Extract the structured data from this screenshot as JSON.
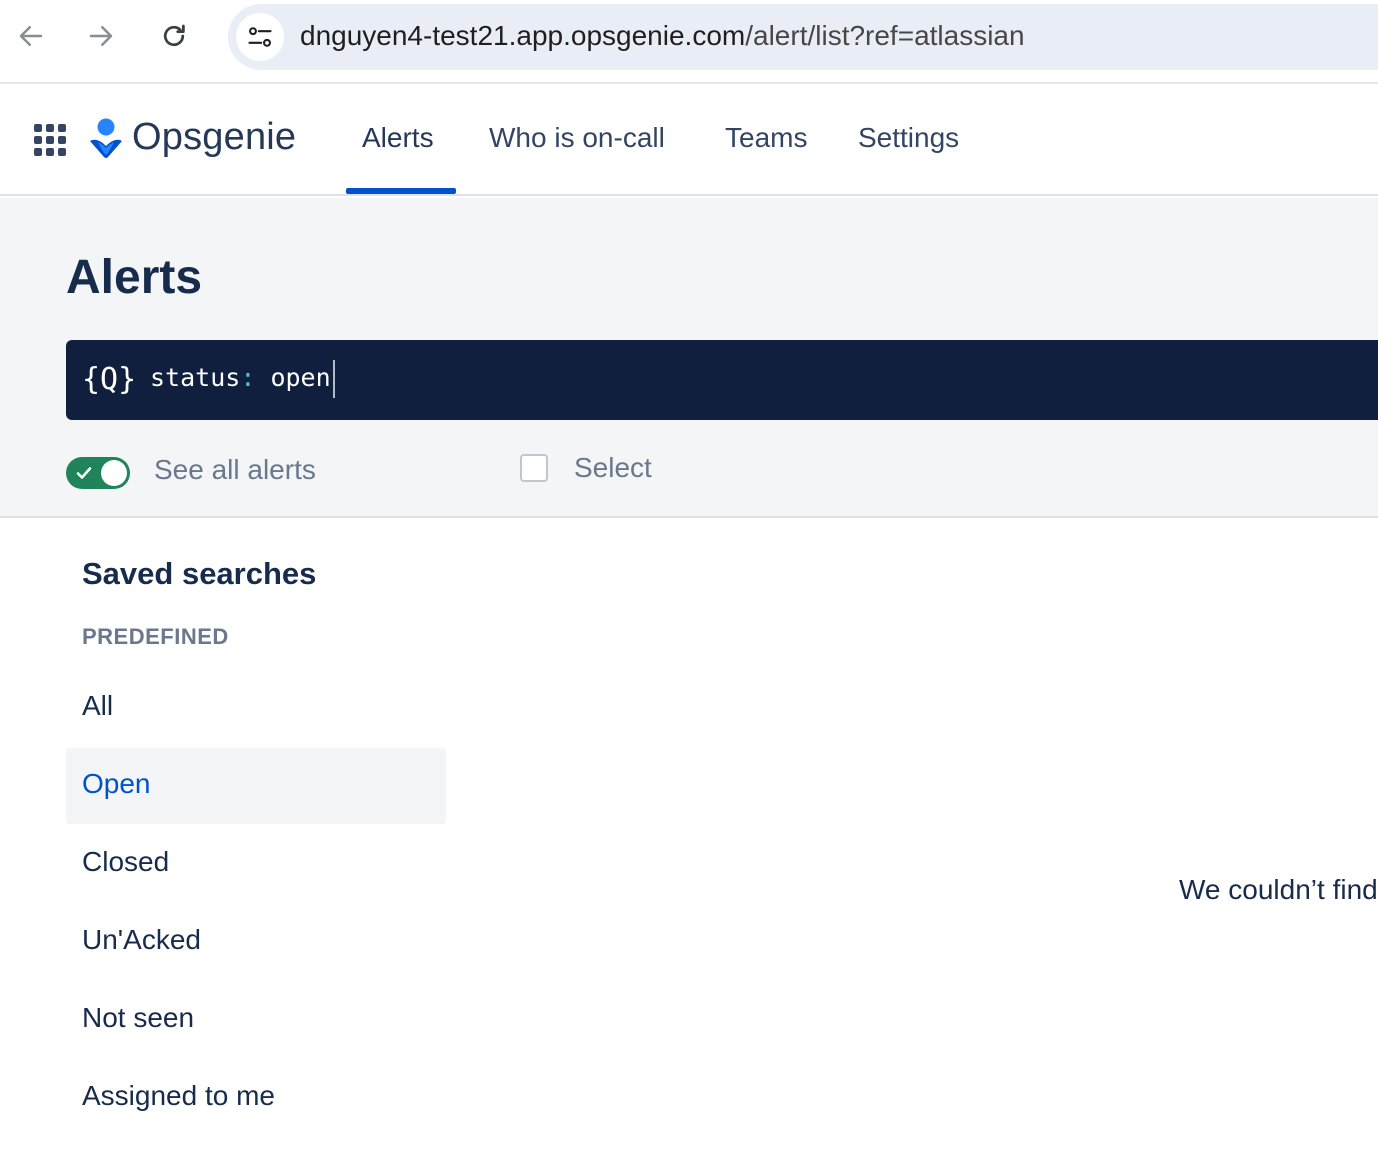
{
  "browser": {
    "url_host": "dnguyen4-test21.app.opsgenie.com",
    "url_path": "/alert/list?ref=atlassian"
  },
  "app": {
    "name": "Opsgenie",
    "nav": [
      "Alerts",
      "Who is on-call",
      "Teams",
      "Settings"
    ],
    "active_tab": "Alerts",
    "accent_color": "#0052cc"
  },
  "page": {
    "title": "Alerts",
    "query_key": "status",
    "query_colon": ":",
    "query_value": "open",
    "search_icon": "{Q}",
    "toggle_label": "See all alerts",
    "toggle_on": true,
    "select_label": "Select"
  },
  "saved_searches": {
    "title": "Saved searches",
    "section": "PREDEFINED",
    "items": [
      "All",
      "Open",
      "Closed",
      "Un'Acked",
      "Not seen",
      "Assigned to me"
    ],
    "selected": "Open"
  },
  "empty_state": {
    "message": "We couldn’t find"
  }
}
